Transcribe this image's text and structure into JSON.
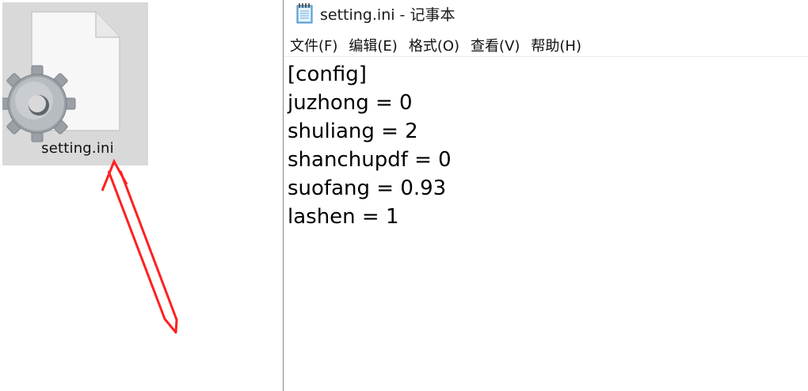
{
  "desktop": {
    "file": {
      "name": "setting.ini",
      "icon": "gear-document-icon"
    },
    "annotation": {
      "type": "red-arrow",
      "color": "#ff2020"
    }
  },
  "notepad": {
    "title": "setting.ini - 记事本",
    "icon": "notepad-icon",
    "menu": [
      {
        "label": "文件(F)"
      },
      {
        "label": "编辑(E)"
      },
      {
        "label": "格式(O)"
      },
      {
        "label": "查看(V)"
      },
      {
        "label": "帮助(H)"
      }
    ],
    "content_lines": [
      "[config]",
      "juzhong = 0",
      "shuliang = 2",
      "shanchupdf = 0",
      "suofang = 0.93",
      "lashen = 1"
    ]
  }
}
